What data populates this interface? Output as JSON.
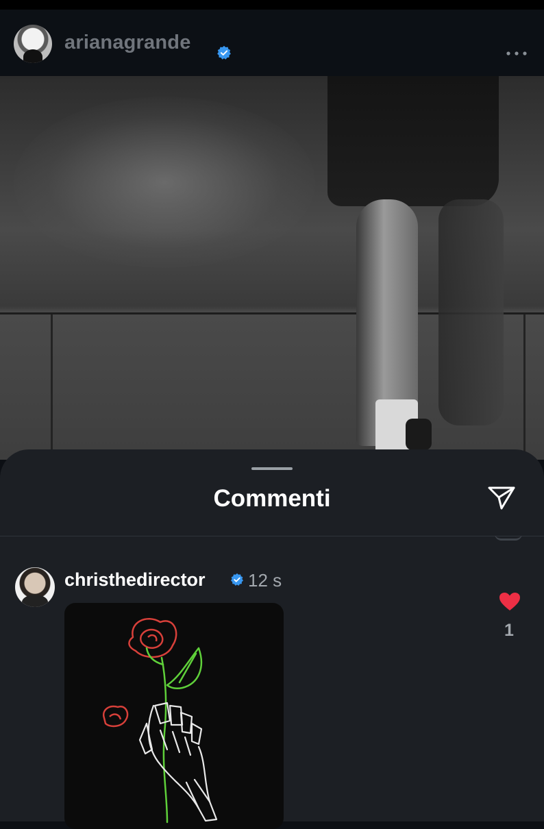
{
  "post": {
    "username": "arianagrande",
    "verified": true,
    "more_icon": "more-horizontal-icon"
  },
  "comments_sheet": {
    "title": "Commenti",
    "share_icon": "send-paper-plane-icon",
    "comments": [
      {
        "username": "christhedirector",
        "verified": true,
        "time": "12 s",
        "media": "neon-skeleton-hand-rose-gif",
        "liked": true,
        "like_count": "1"
      }
    ]
  },
  "colors": {
    "background": "#0c0f14",
    "sheet": "#1c1f24",
    "verified_blue": "#3897f0",
    "like_red": "#ed4956",
    "muted_text": "#a3a8ae"
  }
}
